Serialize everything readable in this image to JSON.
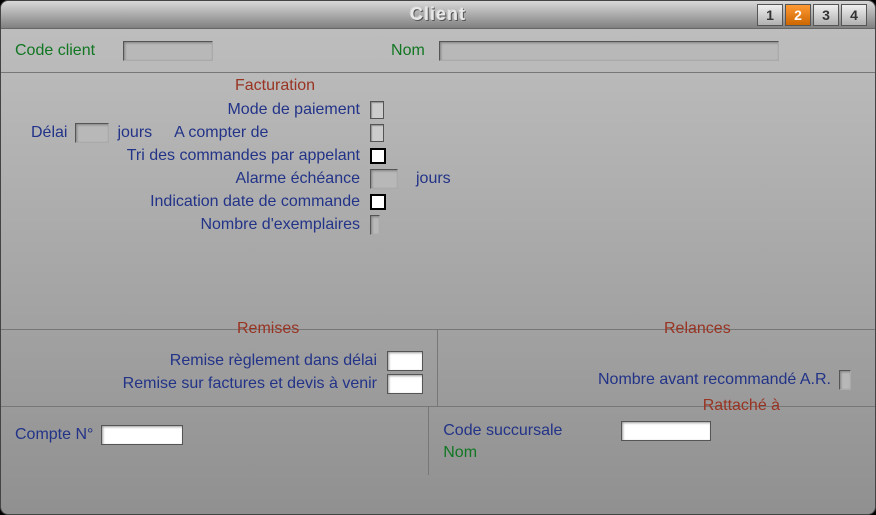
{
  "title": "Client",
  "tabs": {
    "t1": "1",
    "t2": "2",
    "t3": "3",
    "t4": "4"
  },
  "header": {
    "code_client_label": "Code client",
    "code_client_value": "",
    "nom_label": "Nom",
    "nom_value": ""
  },
  "facturation": {
    "title": "Facturation",
    "mode_paiement_label": "Mode de paiement",
    "delai_label": "Délai",
    "delai_value": "",
    "jours_label": "jours",
    "a_compter_label": "A compter de",
    "tri_label": "Tri des commandes par appelant",
    "alarme_label": "Alarme échéance",
    "alarme_value": "",
    "alarme_jours": "jours",
    "indication_label": "Indication date de commande",
    "nb_exemplaires_label": "Nombre d'exemplaires",
    "nb_exemplaires_value": ""
  },
  "remises": {
    "title": "Remises",
    "reglement_label": "Remise règlement dans délai",
    "reglement_value": "",
    "factures_label": "Remise sur factures et devis à venir",
    "factures_value": ""
  },
  "relances": {
    "title": "Relances",
    "nb_avant_label": "Nombre avant recommandé A.R.",
    "nb_avant_value": ""
  },
  "compte": {
    "label": "Compte N°",
    "value": ""
  },
  "rattache": {
    "title": "Rattaché à",
    "code_succ_label": "Code succursale",
    "code_succ_value": "",
    "nom_label": "Nom",
    "nom_value": ""
  }
}
